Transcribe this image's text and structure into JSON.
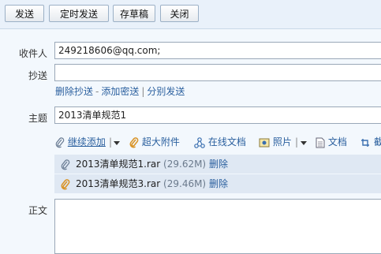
{
  "toolbar": {
    "send": "发送",
    "schedule_send": "定时发送",
    "save_draft": "存草稿",
    "close": "关闭"
  },
  "form": {
    "to_label": "收件人",
    "to_value": "249218606@qq.com;",
    "cc_label": "抄送",
    "cc_value": "",
    "subject_label": "主题",
    "subject_value": "2013清单规范1",
    "body_label": "正文"
  },
  "links": {
    "remove_cc": "删除抄送",
    "sep1": "-",
    "add_bcc": "添加密送",
    "sep2": "|",
    "separate_send": "分别发送"
  },
  "attach_toolbar": {
    "continue_add": "继续添加",
    "large_attachment": "超大附件",
    "online_doc": "在线文档",
    "photo": "照片",
    "photo_sep": "|",
    "doc": "文档",
    "partial": "截"
  },
  "attachments": [
    {
      "name": "2013清单规范1.rar",
      "size": "(29.62M)",
      "action": "删除"
    },
    {
      "name": "2013清单规范3.rar",
      "size": "(29.46M)",
      "action": "删除"
    }
  ],
  "colors": {
    "link": "#2a5f9e",
    "attachment_row_bg": "#dfe8f3",
    "page_bg": "#f3f8fd"
  },
  "icons": {
    "paperclip": "paperclip-icon",
    "large_attachment": "large-attachment-icon",
    "online_doc": "share-nodes-icon",
    "photo": "photo-icon",
    "doc": "document-icon",
    "screenshot": "screenshot-icon",
    "dropdown": "caret-down-icon"
  }
}
